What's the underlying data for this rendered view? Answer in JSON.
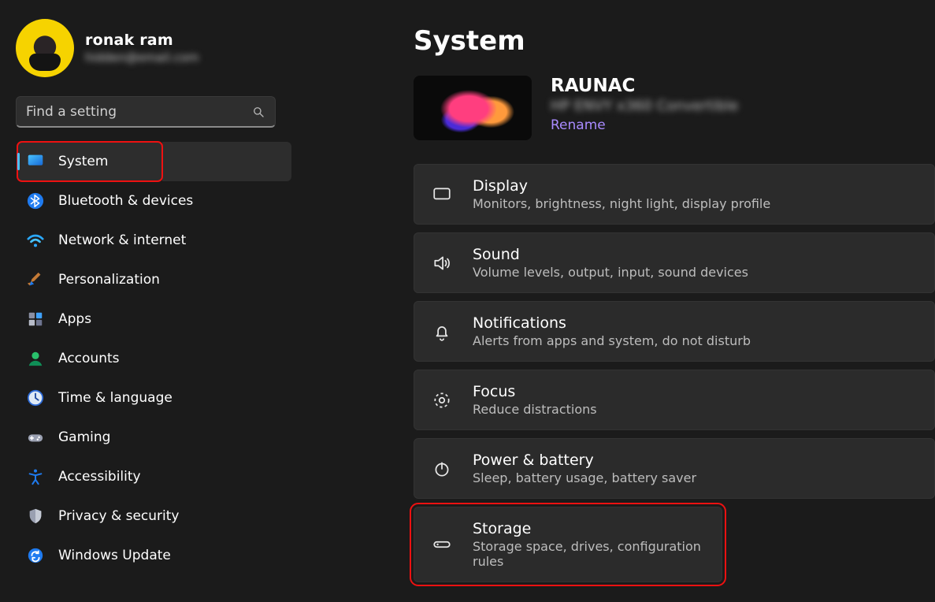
{
  "user": {
    "name": "ronak ram",
    "email": "hidden@email.com"
  },
  "search": {
    "placeholder": "Find a setting"
  },
  "sidebar": {
    "items": [
      {
        "id": "system",
        "label": "System",
        "selected": true,
        "highlight": true
      },
      {
        "id": "bluetooth",
        "label": "Bluetooth & devices"
      },
      {
        "id": "network",
        "label": "Network & internet"
      },
      {
        "id": "personalization",
        "label": "Personalization"
      },
      {
        "id": "apps",
        "label": "Apps"
      },
      {
        "id": "accounts",
        "label": "Accounts"
      },
      {
        "id": "time",
        "label": "Time & language"
      },
      {
        "id": "gaming",
        "label": "Gaming"
      },
      {
        "id": "accessibility",
        "label": "Accessibility"
      },
      {
        "id": "privacy",
        "label": "Privacy & security"
      },
      {
        "id": "update",
        "label": "Windows Update"
      }
    ]
  },
  "page": {
    "title": "System",
    "device": {
      "name": "RAUNAC",
      "model": "HP ENVY x360 Convertible",
      "rename": "Rename"
    },
    "cards": [
      {
        "id": "display",
        "title": "Display",
        "sub": "Monitors, brightness, night light, display profile"
      },
      {
        "id": "sound",
        "title": "Sound",
        "sub": "Volume levels, output, input, sound devices"
      },
      {
        "id": "notifications",
        "title": "Notifications",
        "sub": "Alerts from apps and system, do not disturb"
      },
      {
        "id": "focus",
        "title": "Focus",
        "sub": "Reduce distractions"
      },
      {
        "id": "power",
        "title": "Power & battery",
        "sub": "Sleep, battery usage, battery saver"
      },
      {
        "id": "storage",
        "title": "Storage",
        "sub": "Storage space, drives, configuration rules",
        "highlight": true
      }
    ]
  }
}
